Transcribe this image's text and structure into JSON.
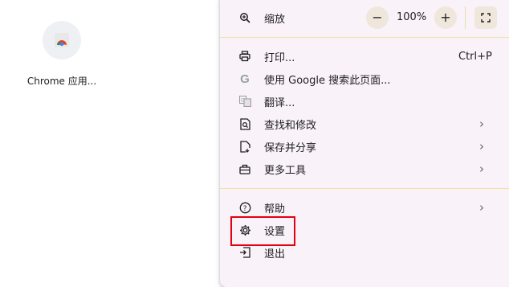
{
  "desktop": {
    "shortcut_label": "Chrome 应用...",
    "shortcut_icon": "chrome-logo-icon"
  },
  "menu": {
    "zoom": {
      "label": "缩放",
      "value": "100%",
      "minus": "−",
      "plus": "+",
      "icon": "zoom-icon",
      "fullscreen_icon": "fullscreen-icon"
    },
    "print": {
      "label": "打印...",
      "shortcut": "Ctrl+P",
      "icon": "print-icon"
    },
    "search_google": {
      "label": "使用 Google 搜索此页面...",
      "icon": "google-icon"
    },
    "translate": {
      "label": "翻译...",
      "icon": "translate-icon"
    },
    "find_edit": {
      "label": "查找和修改",
      "icon": "find-icon"
    },
    "save_share": {
      "label": "保存并分享",
      "icon": "save-share-icon"
    },
    "more_tools": {
      "label": "更多工具",
      "icon": "toolbox-icon"
    },
    "help": {
      "label": "帮助",
      "icon": "help-icon"
    },
    "settings": {
      "label": "设置",
      "icon": "gear-icon"
    },
    "exit": {
      "label": "退出",
      "icon": "exit-icon"
    },
    "chevron": "›"
  },
  "colors": {
    "menu_bg": "#f9f2f9",
    "highlight": "#e3000f"
  }
}
